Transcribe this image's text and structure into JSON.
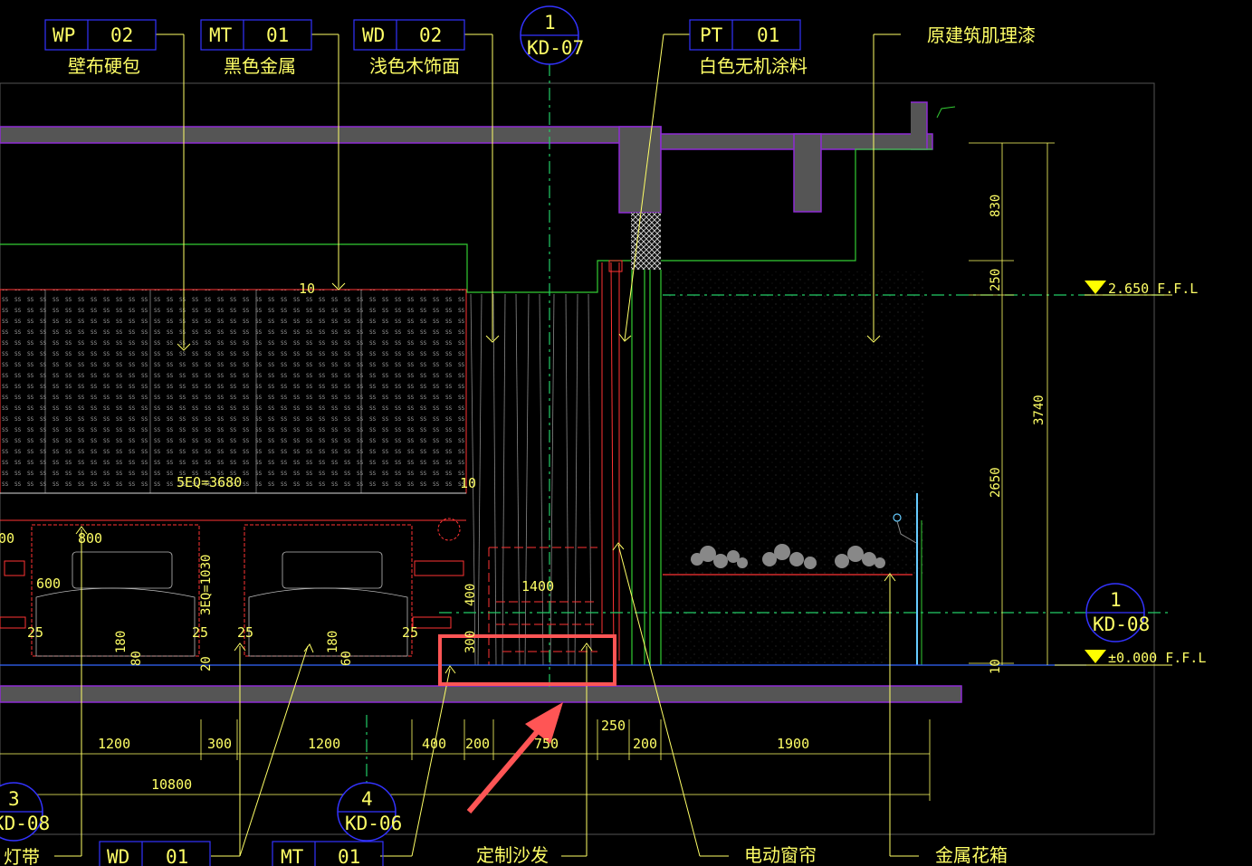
{
  "colors": {
    "background": "#000000",
    "leader": "#ffff66",
    "frame": "#6a1bb0",
    "highlight": "#ff4d4d",
    "arrow": "#ff5555",
    "wall": "#33cc33",
    "axis": "#22cc66"
  },
  "material_tags": [
    {
      "code": "WP",
      "num": "02",
      "desc": "壁布硬包"
    },
    {
      "code": "MT",
      "num": "01",
      "desc": "黑色金属"
    },
    {
      "code": "WD",
      "num": "02",
      "desc": "浅色木饰面"
    },
    {
      "code": "PT",
      "num": "01",
      "desc": "白色无机涂料"
    }
  ],
  "note_top_right": "原建筑肌理漆",
  "section_markers": [
    {
      "num": "1",
      "ref": "KD-07"
    },
    {
      "num": "1",
      "ref": "KD-08"
    },
    {
      "num": "3",
      "ref": "KD-08"
    },
    {
      "num": "4",
      "ref": "KD-06"
    }
  ],
  "levels": {
    "upper": "2.650 F.F.L",
    "lower": "±0.000 F.F.L"
  },
  "vertical_dims": {
    "d830": "830",
    "d250": "250",
    "d3740": "3740",
    "d2650": "2650",
    "d10": "10"
  },
  "bottom_dims": {
    "d1200a": "1200",
    "d300": "300",
    "d1200b": "1200",
    "d400": "400",
    "d200a": "200",
    "d750": "750",
    "d250": "250",
    "d200b": "200",
    "d1900": "1900",
    "total": "10800"
  },
  "inner_dims": {
    "eq5": "5EQ=3680",
    "eq3": "3EQ=1030",
    "d800": "800",
    "d600": "600",
    "d1400": "1400",
    "d400v": "400",
    "d300v": "300",
    "d180a": "180",
    "d180b": "180",
    "d80": "80",
    "d60": "60",
    "d20": "20",
    "d25a": "25",
    "d25b": "25",
    "d25c": "25",
    "d25d": "25",
    "d10a": "10",
    "d10b": "10",
    "d600l": "600",
    "d00": "00"
  },
  "bottom_labels": {
    "light_strip": "灯带",
    "wd_code": "WD",
    "wd_num": "01",
    "mt_code": "MT",
    "mt_num": "01",
    "sofa": "定制沙发",
    "curtain": "电动窗帘",
    "planter": "金属花箱"
  }
}
